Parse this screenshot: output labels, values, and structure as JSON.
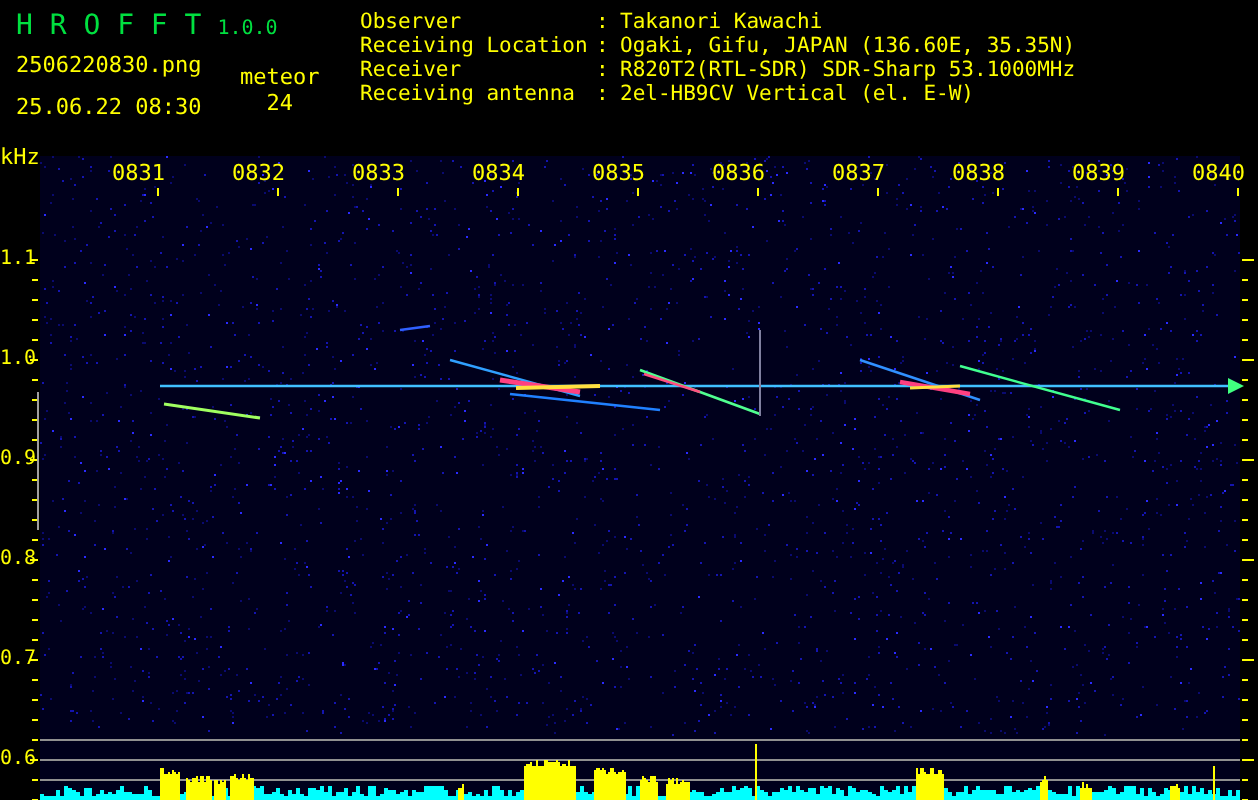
{
  "app": {
    "title": "H R O F F T",
    "version": "1.0.0"
  },
  "file_name": "2506220830.png",
  "timestamp": "25.06.22 08:30",
  "meteor": {
    "label": "meteor",
    "count": "24"
  },
  "info": [
    {
      "label": "Observer",
      "separator": ":",
      "value": "Takanori Kawachi"
    },
    {
      "label": "Receiving Location",
      "separator": ":",
      "value": "Ogaki, Gifu, JAPAN (136.60E, 35.35N)"
    },
    {
      "label": "Receiver",
      "separator": ":",
      "value": "R820T2(RTL-SDR) SDR-Sharp 53.1000MHz"
    },
    {
      "label": "Receiving antenna",
      "separator": ":",
      "value": "2el-HB9CV Vertical (el. E-W)"
    }
  ],
  "y_unit": "kHz",
  "x_labels": [
    "0831",
    "0832",
    "0833",
    "0834",
    "0835",
    "0836",
    "0837",
    "0838",
    "0839",
    "0840"
  ],
  "y_labels": [
    "1.1",
    "1.0",
    "0.9",
    "0.8",
    "0.7",
    "0.6"
  ]
}
